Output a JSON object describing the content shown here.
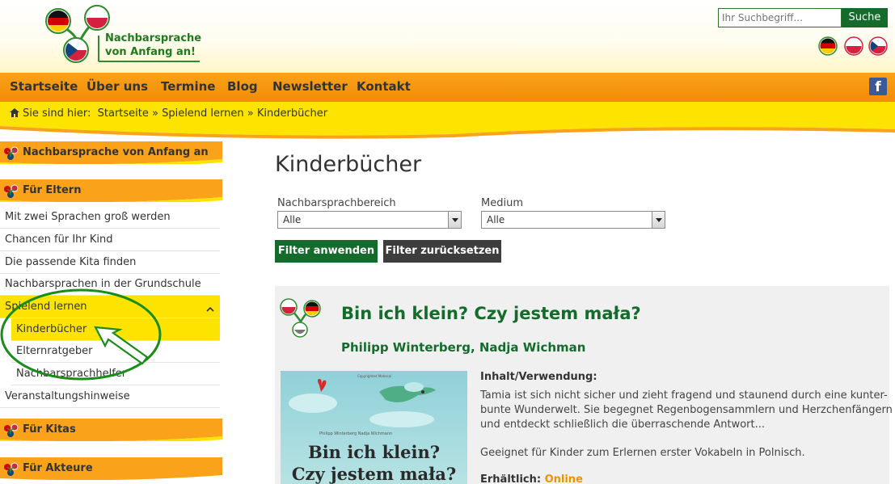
{
  "header": {
    "logo_line1": "Nachbarsprache",
    "logo_line2": "von Anfang an!",
    "search_placeholder": "Ihr Suchbegriff...",
    "search_button": "Suche",
    "languages": [
      "de-flag-icon",
      "pl-flag-icon",
      "cz-flag-icon"
    ]
  },
  "nav": {
    "items": [
      "Startseite",
      "Über uns",
      "Termine",
      "Blog",
      "Newsletter",
      "Kontakt"
    ],
    "facebook": "f"
  },
  "breadcrumb": {
    "prefix": "Sie sind hier:",
    "path": "Startseite » Spielend lernen » Kinderbücher"
  },
  "sidebar": {
    "head1": "Nachbarsprache von Anfang an",
    "head2": "Für Eltern",
    "items": [
      "Mit zwei Sprachen groß werden",
      "Chancen für Ihr Kind",
      "Die passende Kita finden",
      "Nachbarsprachen in der Grundschule",
      "Spielend lernen"
    ],
    "subitems": [
      "Kinderbücher",
      "Elternratgeber",
      "Nachbarsprachhelfer"
    ],
    "item_after": "Veranstaltungshinweise",
    "head3": "Für Kitas",
    "head4": "Für Akteure"
  },
  "main": {
    "title": "Kinderbücher",
    "filter1_label": "Nachbarsprachbereich",
    "filter1_value": "Alle",
    "filter2_label": "Medium",
    "filter2_value": "Alle",
    "apply": "Filter anwenden",
    "reset": "Filter zurücksetzen"
  },
  "book": {
    "title": "Bin ich klein? Czy jestem mała?",
    "authors": "Philipp Winterberg, Nadja Wichman",
    "cover_title1": "Bin ich klein?",
    "cover_title2": "Czy jestem mała?",
    "cover_authors": "Philipp Winterberg   Nadja Wichmann",
    "cover_copyright": "Copyrighted Material",
    "info_label": "Inhalt/Verwendung:",
    "info_line1": "Tamia ist sich nicht sicher und zieht fragend und staunend durch eine kunter-",
    "info_line2": "bunte Wunderwelt. Sie begegnet Regenbogensammlern und Herzchenfängern",
    "info_line3": "und entdeckt schließlich die überraschende Antwort...",
    "info_line4": "Geeignet für Kinder zum Erlernen erster Vokabeln in Polnisch.",
    "available_label": "Erhältlich:",
    "available_link": "Online"
  },
  "colors": {
    "orange": "#f28c05",
    "green": "#146b2c",
    "yellow": "#fde300"
  }
}
